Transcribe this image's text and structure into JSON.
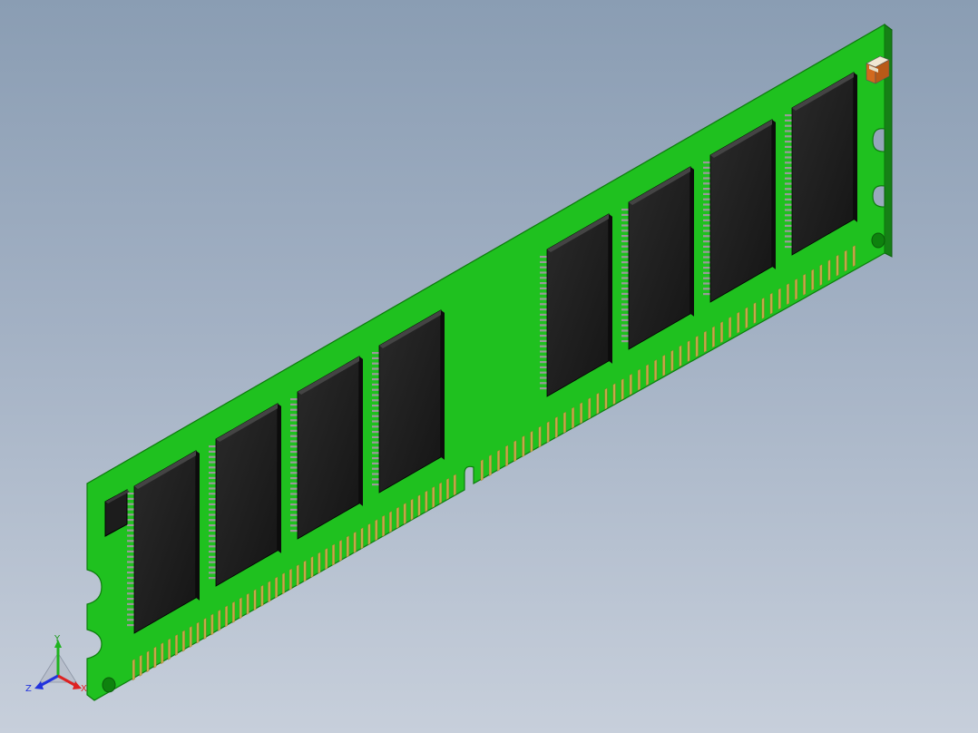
{
  "viewport": {
    "background_top": "#8a9db3",
    "background_bottom": "#c7cfdb"
  },
  "model": {
    "pcb_color": "#1fc11f",
    "pcb_edge_color": "#0d8a0d",
    "chip_color": "#1e1e1e",
    "pin_color": "#c9a64a",
    "capacitor_color": "#d2691e",
    "chip_count": 8,
    "edge_contact_count": 92
  },
  "triad": {
    "y_label": "Y",
    "z_label": "Z",
    "x_label": "X",
    "y_color": "#1fb31f",
    "z_color": "#2233dd",
    "x_color": "#dd2222"
  }
}
